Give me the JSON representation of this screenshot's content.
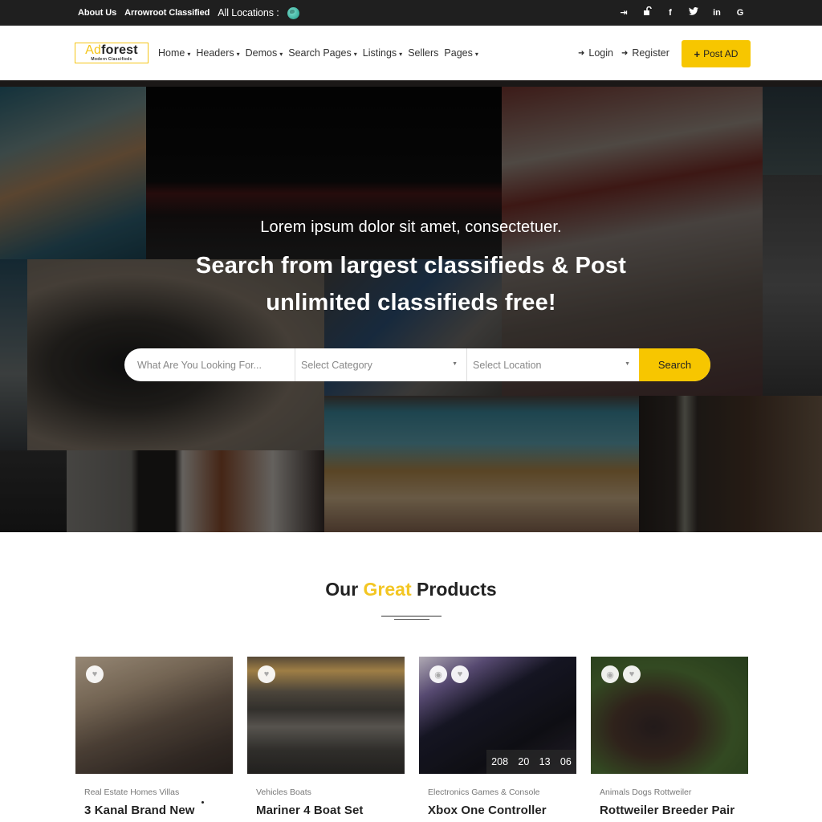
{
  "topbar": {
    "links": [
      "About Us",
      "Arrowroot Classified"
    ],
    "locations_label": "All Locations :",
    "icons": [
      "sign-in-icon",
      "unlock-icon",
      "facebook-icon",
      "twitter-icon",
      "linkedin-icon",
      "google-icon"
    ],
    "icon_glyphs": [
      "⇥",
      "🔓",
      "f",
      "t",
      "in",
      "G"
    ]
  },
  "header": {
    "logo": {
      "ad": "Ad",
      "forest": "forest",
      "tagline": "Modern Classifieds"
    },
    "nav": [
      {
        "label": "Home",
        "dropdown": true
      },
      {
        "label": "Headers",
        "dropdown": true
      },
      {
        "label": "Demos",
        "dropdown": true
      },
      {
        "label": "Search Pages",
        "dropdown": true
      },
      {
        "label": "Listings",
        "dropdown": true
      },
      {
        "label": "Sellers",
        "dropdown": false
      },
      {
        "label": "Pages",
        "dropdown": true
      }
    ],
    "login_label": "Login",
    "register_label": "Register",
    "post_ad_label": "Post AD",
    "chevron": "⌄",
    "plus": "+"
  },
  "hero": {
    "subtitle": "Lorem ipsum dolor sit amet, consectetuer.",
    "title_line1": "Search from largest classifieds & Post",
    "title_line2": "unlimited classifieds free!",
    "search": {
      "keyword_placeholder": "What Are You Looking For...",
      "category_placeholder": "Select Category",
      "location_placeholder": "Select Location",
      "button_label": "Search",
      "caret": "▼"
    }
  },
  "products": {
    "title_pre": "Our",
    "title_highlight": "Great",
    "title_post": "Products",
    "cards": [
      {
        "category": "Real Estate Homes Villas",
        "name": "3 Kanal Brand New",
        "has_video": false,
        "countdown": null
      },
      {
        "category": "Vehicles Boats",
        "name": "Mariner 4 Boat Set",
        "has_video": false,
        "countdown": null
      },
      {
        "category": "Electronics Games & Console",
        "name": "Xbox One Controller",
        "has_video": true,
        "countdown": [
          "208",
          "20",
          "13",
          "06"
        ]
      },
      {
        "category": "Animals Dogs Rottweiler",
        "name": "Rottweiler Breeder Pair",
        "has_video": true,
        "countdown": null
      }
    ],
    "heart_icon": "♥",
    "play_icon": "◉"
  },
  "colors": {
    "accent": "#f7c600",
    "topbar_bg": "#1f1f1f",
    "title_highlight": "#f3c623"
  }
}
